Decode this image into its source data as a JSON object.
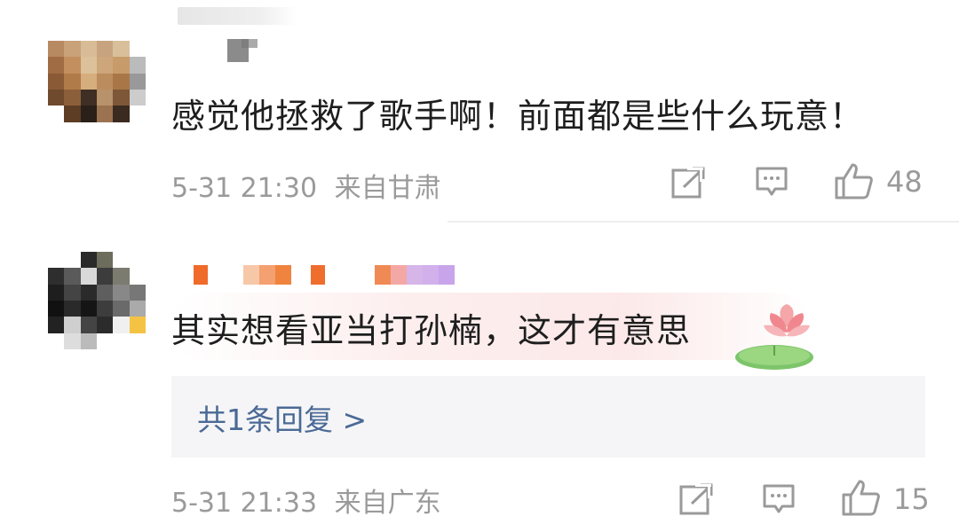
{
  "comments": [
    {
      "text": "感觉他拯救了歌手啊！前面都是些什么玩意！",
      "time": "5-31 21:30",
      "location": "来自甘肃",
      "likes": "48",
      "icons": [
        "share-icon",
        "comment-icon",
        "like-icon"
      ]
    },
    {
      "text": "其实想看亚当打孙楠，这才有意思",
      "time": "5-31 21:33",
      "location": "来自广东",
      "likes": "15",
      "reply_link": "共1条回复 >",
      "icons": [
        "share-icon",
        "comment-icon",
        "like-icon",
        "lotus-icon"
      ]
    }
  ],
  "colors": {
    "text": "#1e1e1e",
    "meta": "#9a9a9a",
    "reply_link": "#4a6a95",
    "reply_bg": "#f5f5f7"
  }
}
